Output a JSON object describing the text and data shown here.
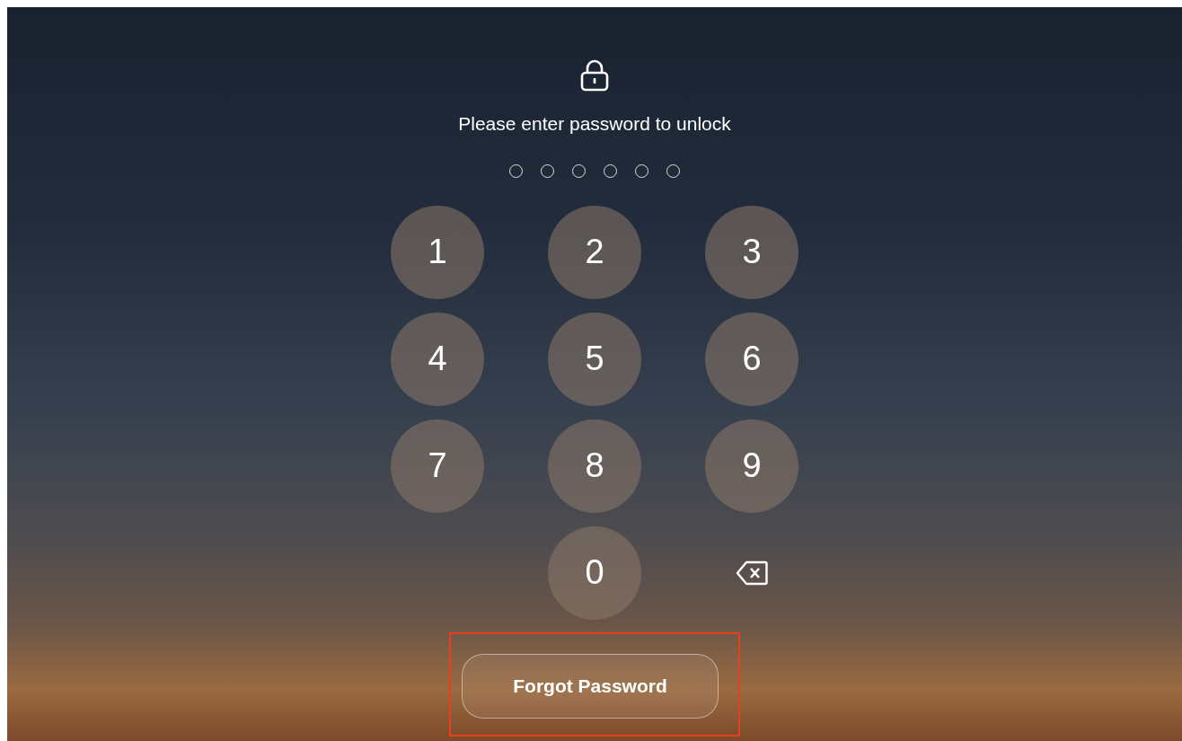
{
  "prompt": "Please enter password to unlock",
  "pin_dots": [
    {
      "filled": false
    },
    {
      "filled": false
    },
    {
      "filled": false
    },
    {
      "filled": false
    },
    {
      "filled": false
    },
    {
      "filled": false
    }
  ],
  "keys": [
    {
      "kind": "digit",
      "label": "1"
    },
    {
      "kind": "digit",
      "label": "2"
    },
    {
      "kind": "digit",
      "label": "3"
    },
    {
      "kind": "digit",
      "label": "4"
    },
    {
      "kind": "digit",
      "label": "5"
    },
    {
      "kind": "digit",
      "label": "6"
    },
    {
      "kind": "digit",
      "label": "7"
    },
    {
      "kind": "digit",
      "label": "8"
    },
    {
      "kind": "digit",
      "label": "9"
    },
    {
      "kind": "blank"
    },
    {
      "kind": "digit",
      "label": "0"
    },
    {
      "kind": "backspace"
    }
  ],
  "forgot_button": {
    "label": "Forgot Password",
    "highlighted": true
  }
}
